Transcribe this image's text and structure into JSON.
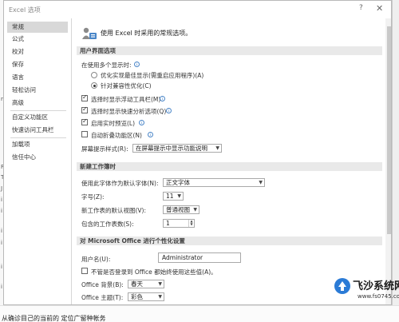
{
  "background": {
    "left_marks": [
      "r",
      "F",
      "T",
      "J",
      "i",
      "i",
      "i",
      "i",
      "i",
      "i"
    ],
    "bottom_text": "从确诊目己的当前的 定位广留种帐务"
  },
  "dialog": {
    "title": "Excel 选项",
    "help_glyph": "?",
    "close_glyph": "✕"
  },
  "sidebar": {
    "items": [
      {
        "label": "常规",
        "active": true
      },
      {
        "label": "公式"
      },
      {
        "label": "校对"
      },
      {
        "label": "保存"
      },
      {
        "label": "语言"
      },
      {
        "label": "轻松访问"
      },
      {
        "label": "高级"
      },
      {
        "label": "自定义功能区"
      },
      {
        "label": "快速访问工具栏"
      },
      {
        "label": "加载项"
      },
      {
        "label": "信任中心"
      }
    ]
  },
  "content": {
    "intro_text": "使用 Excel 时采用的常规选项。",
    "ui_section": {
      "header": "用户界面选项",
      "multi_display_label": "在使用多个显示时:",
      "radio_optimize": "优化实现最佳显示(需重启应用程序)(A)",
      "radio_compat": "针对兼容性优化(C)",
      "cb_minitoolbar": "选择时显示浮动工具栏(M)",
      "cb_quickanalysis": "选择时显示快速分析选项(Q)",
      "cb_livepreview": "启用实时预览(L)",
      "cb_collapse_ribbon": "自动折叠功能区(N)",
      "screentip_label": "屏幕提示样式(R):",
      "screentip_value": "在屏幕提示中显示功能说明"
    },
    "workbook_section": {
      "header": "新建工作簿时",
      "font_label": "使用此字体作为默认字体(N):",
      "font_value": "正文字体",
      "size_label": "字号(Z):",
      "size_value": "11",
      "view_label": "新工作表的默认视图(V):",
      "view_value": "普通视图",
      "sheets_label": "包含的工作表数(S):",
      "sheets_value": "1"
    },
    "personalize_section": {
      "header": "对 Microsoft Office 进行个性化设置",
      "username_label": "用户名(U):",
      "username_value": "Administrator",
      "cb_always_use": "不管是否登录到 Office 都始终使用这些值(A)。",
      "background_label": "Office 背景(B):",
      "background_value": "春天",
      "theme_label": "Office 主题(T):",
      "theme_value": "彩色"
    }
  },
  "watermark": {
    "title": "飞沙系统网",
    "url": "www.fs0745.com"
  },
  "colors": {
    "accent": "#4a86c8",
    "section_bg": "#e9e9e9",
    "active_nav": "#d8d8d8"
  }
}
